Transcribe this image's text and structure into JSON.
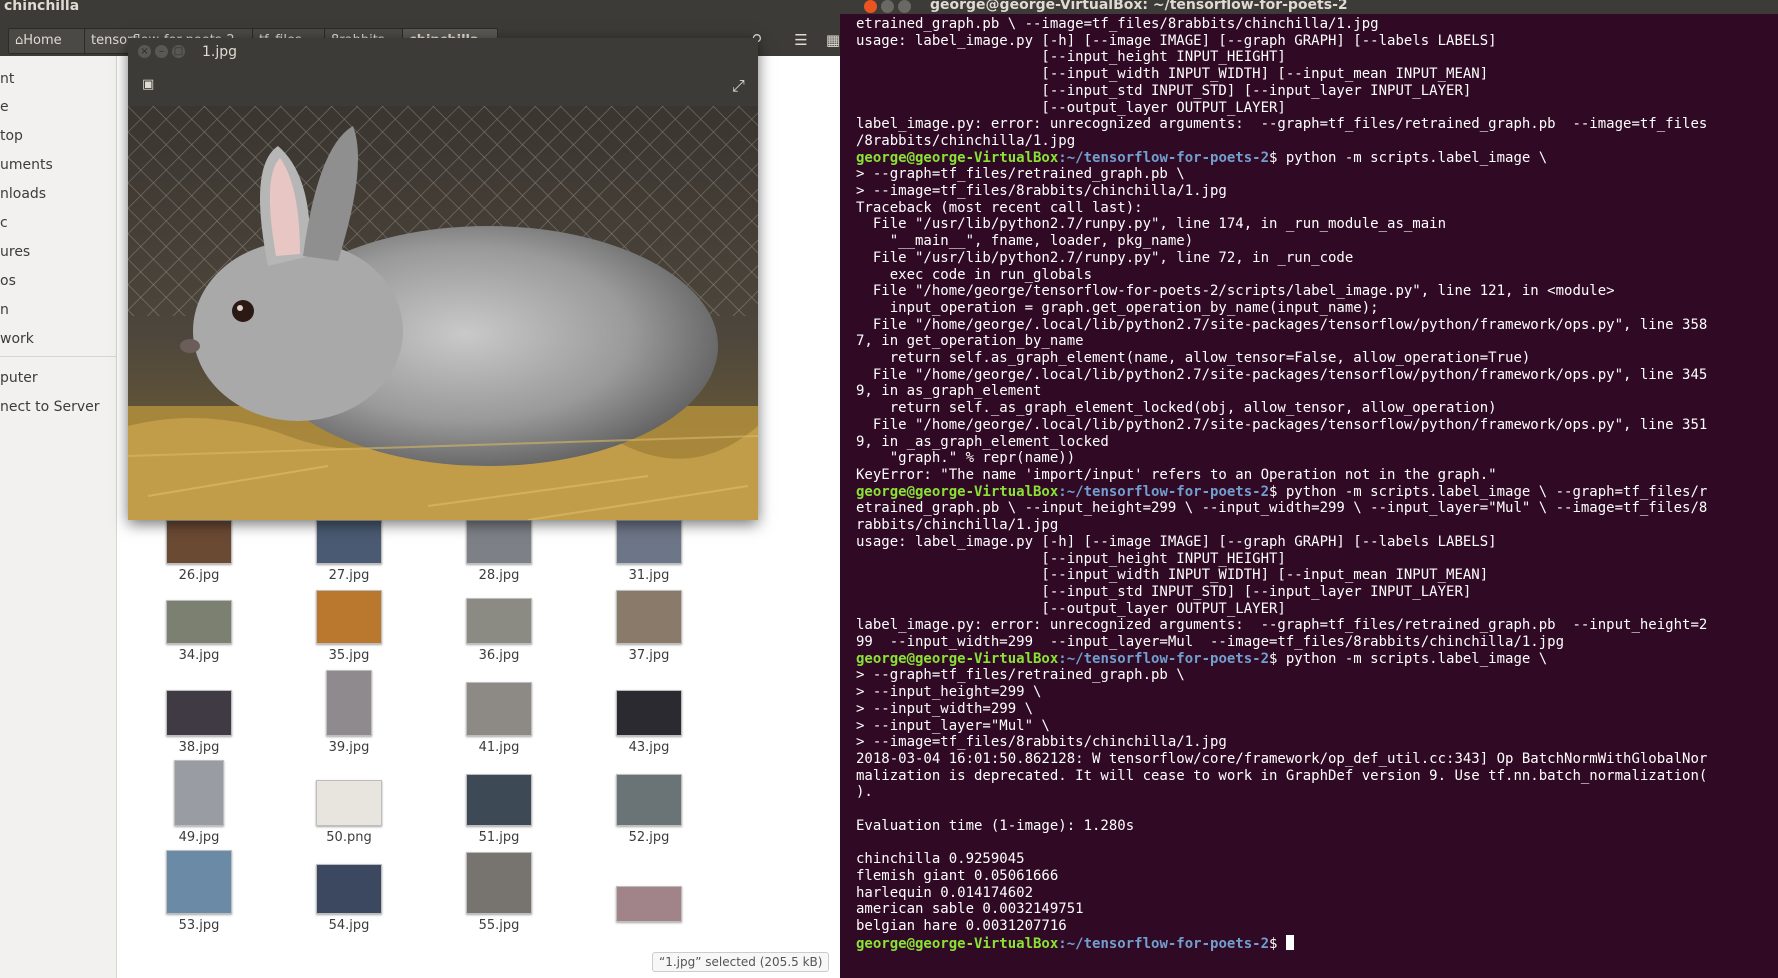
{
  "file_manager": {
    "window_title": "chinchilla",
    "breadcrumbs": [
      "Home",
      "tensorflow-for-poets-2",
      "tf_files",
      "8rabbits",
      "chinchilla"
    ],
    "sidebar": [
      "nt",
      "e",
      "top",
      "uments",
      "nloads",
      "c",
      "ures",
      "os",
      "n",
      "work",
      "puter",
      "nect to Server"
    ],
    "thumbnails": [
      {
        "name": "26.jpg",
        "color": "#6b4a33"
      },
      {
        "name": "27.jpg",
        "color": "#4a5a72"
      },
      {
        "name": "28.jpg",
        "color": "#7d8087"
      },
      {
        "name": "31.jpg",
        "color": "#6d7688"
      },
      {
        "name": "34.jpg",
        "color": "#7b8070"
      },
      {
        "name": "35.jpg",
        "color": "#b9782e"
      },
      {
        "name": "36.jpg",
        "color": "#8b8b84"
      },
      {
        "name": "37.jpg",
        "color": "#8a7a6a"
      },
      {
        "name": "38.jpg",
        "color": "#3f3a44"
      },
      {
        "name": "39.jpg",
        "color": "#8e8a8e"
      },
      {
        "name": "41.jpg",
        "color": "#8d8a86"
      },
      {
        "name": "43.jpg",
        "color": "#2a2a30"
      },
      {
        "name": "49.jpg",
        "color": "#9a9ca4"
      },
      {
        "name": "50.png",
        "color": "#e8e4de"
      },
      {
        "name": "51.jpg",
        "color": "#3d4a55"
      },
      {
        "name": "52.jpg",
        "color": "#6a7376"
      },
      {
        "name": "53.jpg",
        "color": "#6a8aa6"
      },
      {
        "name": "54.jpg",
        "color": "#3c4860"
      },
      {
        "name": "55.jpg",
        "color": "#77736e"
      },
      {
        "name": "",
        "color": "#a0848a"
      }
    ],
    "status": "“1.jpg” selected  (205.5 kB)"
  },
  "viewer": {
    "title": "1.jpg"
  },
  "terminal": {
    "title": "george@george-VirtualBox: ~/tensorflow-for-poets-2",
    "prompt_user": "george@george-VirtualBox",
    "prompt_path": ":~/tensorflow-for-poets-2",
    "lines": [
      {
        "t": "etrained_graph.pb \\ --image=tf_files/8rabbits/chinchilla/1.jpg"
      },
      {
        "t": "usage: label_image.py [-h] [--image IMAGE] [--graph GRAPH] [--labels LABELS]"
      },
      {
        "t": "                      [--input_height INPUT_HEIGHT]"
      },
      {
        "t": "                      [--input_width INPUT_WIDTH] [--input_mean INPUT_MEAN]"
      },
      {
        "t": "                      [--input_std INPUT_STD] [--input_layer INPUT_LAYER]"
      },
      {
        "t": "                      [--output_layer OUTPUT_LAYER]"
      },
      {
        "t": "label_image.py: error: unrecognized arguments:  --graph=tf_files/retrained_graph.pb  --image=tf_files"
      },
      {
        "t": "/8rabbits/chinchilla/1.jpg"
      },
      {
        "p": true,
        "t": "$ python -m scripts.label_image \\"
      },
      {
        "t": "> --graph=tf_files/retrained_graph.pb \\"
      },
      {
        "t": "> --image=tf_files/8rabbits/chinchilla/1.jpg"
      },
      {
        "t": "Traceback (most recent call last):"
      },
      {
        "t": "  File \"/usr/lib/python2.7/runpy.py\", line 174, in _run_module_as_main"
      },
      {
        "t": "    \"__main__\", fname, loader, pkg_name)"
      },
      {
        "t": "  File \"/usr/lib/python2.7/runpy.py\", line 72, in _run_code"
      },
      {
        "t": "    exec code in run_globals"
      },
      {
        "t": "  File \"/home/george/tensorflow-for-poets-2/scripts/label_image.py\", line 121, in <module>"
      },
      {
        "t": "    input_operation = graph.get_operation_by_name(input_name);"
      },
      {
        "t": "  File \"/home/george/.local/lib/python2.7/site-packages/tensorflow/python/framework/ops.py\", line 358"
      },
      {
        "t": "7, in get_operation_by_name"
      },
      {
        "t": "    return self.as_graph_element(name, allow_tensor=False, allow_operation=True)"
      },
      {
        "t": "  File \"/home/george/.local/lib/python2.7/site-packages/tensorflow/python/framework/ops.py\", line 345"
      },
      {
        "t": "9, in as_graph_element"
      },
      {
        "t": "    return self._as_graph_element_locked(obj, allow_tensor, allow_operation)"
      },
      {
        "t": "  File \"/home/george/.local/lib/python2.7/site-packages/tensorflow/python/framework/ops.py\", line 351"
      },
      {
        "t": "9, in _as_graph_element_locked"
      },
      {
        "t": "    \"graph.\" % repr(name))"
      },
      {
        "t": "KeyError: \"The name 'import/input' refers to an Operation not in the graph.\""
      },
      {
        "p": true,
        "t": "$ python -m scripts.label_image \\ --graph=tf_files/r"
      },
      {
        "t": "etrained_graph.pb \\ --input_height=299 \\ --input_width=299 \\ --input_layer=\"Mul\" \\ --image=tf_files/8"
      },
      {
        "t": "rabbits/chinchilla/1.jpg"
      },
      {
        "t": "usage: label_image.py [-h] [--image IMAGE] [--graph GRAPH] [--labels LABELS]"
      },
      {
        "t": "                      [--input_height INPUT_HEIGHT]"
      },
      {
        "t": "                      [--input_width INPUT_WIDTH] [--input_mean INPUT_MEAN]"
      },
      {
        "t": "                      [--input_std INPUT_STD] [--input_layer INPUT_LAYER]"
      },
      {
        "t": "                      [--output_layer OUTPUT_LAYER]"
      },
      {
        "t": "label_image.py: error: unrecognized arguments:  --graph=tf_files/retrained_graph.pb  --input_height=2"
      },
      {
        "t": "99  --input_width=299  --input_layer=Mul  --image=tf_files/8rabbits/chinchilla/1.jpg"
      },
      {
        "p": true,
        "t": "$ python -m scripts.label_image \\"
      },
      {
        "t": "> --graph=tf_files/retrained_graph.pb \\"
      },
      {
        "t": "> --input_height=299 \\"
      },
      {
        "t": "> --input_width=299 \\"
      },
      {
        "t": "> --input_layer=\"Mul\" \\"
      },
      {
        "t": "> --image=tf_files/8rabbits/chinchilla/1.jpg"
      },
      {
        "t": "2018-03-04 16:01:50.862128: W tensorflow/core/framework/op_def_util.cc:343] Op BatchNormWithGlobalNor"
      },
      {
        "t": "malization is deprecated. It will cease to work in GraphDef version 9. Use tf.nn.batch_normalization("
      },
      {
        "t": ")."
      },
      {
        "t": ""
      },
      {
        "t": "Evaluation time (1-image): 1.280s"
      },
      {
        "t": ""
      },
      {
        "t": "chinchilla 0.9259045"
      },
      {
        "t": "flemish giant 0.05061666"
      },
      {
        "t": "harlequin 0.014174602"
      },
      {
        "t": "american sable 0.0032149751"
      },
      {
        "t": "belgian hare 0.0031207716"
      },
      {
        "p": true,
        "t": "$ ",
        "cursor": true
      }
    ]
  }
}
